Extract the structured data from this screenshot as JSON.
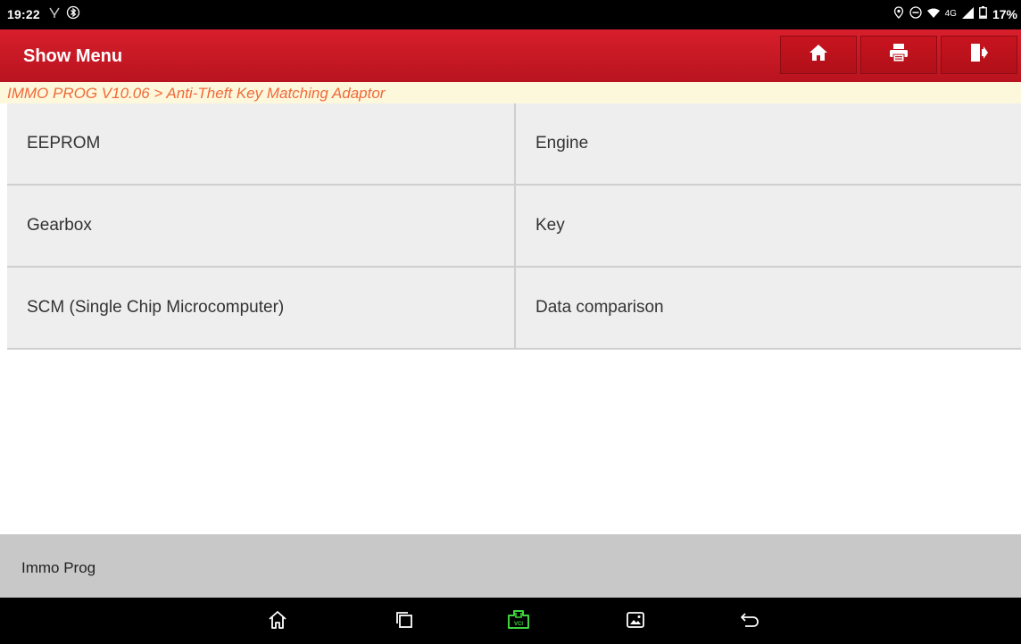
{
  "status_bar": {
    "time": "19:22",
    "signal_label": "4G",
    "battery": "17%"
  },
  "header": {
    "title": "Show Menu",
    "buttons": [
      {
        "icon": "home-icon"
      },
      {
        "icon": "print-icon"
      },
      {
        "icon": "exit-icon"
      }
    ]
  },
  "breadcrumb": {
    "text": "IMMO PROG V10.06 > Anti-Theft Key Matching Adaptor"
  },
  "menu": {
    "rows": [
      {
        "left": "EEPROM",
        "right": "Engine"
      },
      {
        "left": "Gearbox",
        "right": "Key"
      },
      {
        "left": "SCM (Single Chip Microcomputer)",
        "right": "Data comparison"
      }
    ]
  },
  "footer": {
    "label": "Immo Prog"
  },
  "nav_bar": {
    "items": [
      "home-icon",
      "recent-apps-icon",
      "vci-icon",
      "gallery-icon",
      "back-icon"
    ]
  },
  "colors": {
    "header_red": "#c8141f",
    "breadcrumb_text": "#f06a3a",
    "breadcrumb_bg": "#fdf7dc",
    "vci_green": "#3fd43f"
  }
}
